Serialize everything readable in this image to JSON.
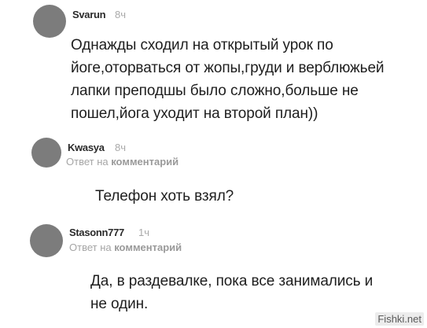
{
  "comments": [
    {
      "author": "Svarun",
      "time": "8ч",
      "text": "Однажды сходил на открытый урок по\nйоге,оторваться от жопы,груди и верблюжьей\nлапки преподшы было сложно,больше не\nпошел,йога уходит на второй план))"
    },
    {
      "author": "Kwasya",
      "time": "8ч",
      "reply_prefix": "Ответ на ",
      "reply_target": "комментарий",
      "text": "Телефон хоть взял?"
    },
    {
      "author": "Stasonn777",
      "time": "1ч",
      "reply_prefix": "Ответ на ",
      "reply_target": "комментарий",
      "text": "Да, в раздевалке, пока все занимались и\nне один."
    }
  ],
  "watermark": "Fishki.net"
}
